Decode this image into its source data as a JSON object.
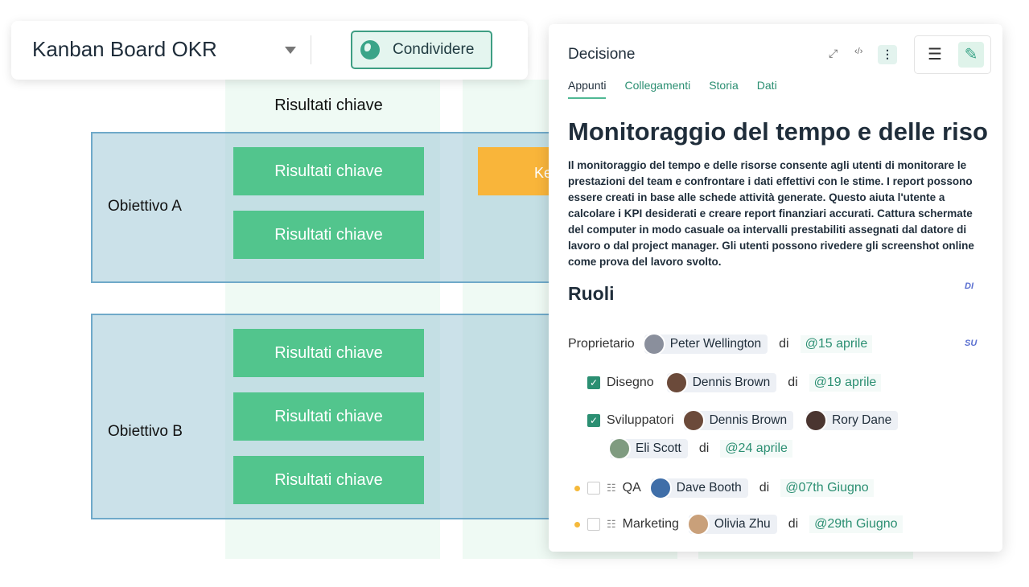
{
  "header": {
    "title": "Kanban Board OKR",
    "share_label": "Condividere"
  },
  "board": {
    "column_header": "Risultati chiave",
    "objectives": [
      {
        "label": "Obiettivo A",
        "key_results": [
          "Risultati chiave",
          "Risultati chiave"
        ],
        "orange_card": "Ke"
      },
      {
        "label": "Obiettivo B",
        "key_results": [
          "Risultati chiave",
          "Risultati chiave",
          "Risultati chiave"
        ]
      }
    ]
  },
  "panel": {
    "title": "Decisione",
    "tabs": [
      "Appunti",
      "Collegamenti",
      "Storia",
      "Dati"
    ],
    "heading": "Monitoraggio del tempo e delle riso",
    "description": "Il monitoraggio del tempo e delle risorse consente agli utenti di monitorare le prestazioni del team e confrontare i dati effettivi con le stime. I report possono essere creati in base alle schede attività generate. Questo aiuta l'utente a calcolare i KPI desiderati e creare report finanziari accurati. Cattura schermate del computer in modo casuale oa intervalli prestabiliti assegnati dal datore di lavoro o dal project manager. Gli utenti possono rivedere gli screenshot online come prova del lavoro svolto.",
    "roles_heading": "Ruoli",
    "side_labels": [
      "DI",
      "SU"
    ],
    "di": "di",
    "roles": [
      {
        "label": "Proprietario",
        "people": [
          "Peter Wellington"
        ],
        "date": "@15 aprile"
      },
      {
        "label": "Disegno",
        "checked": true,
        "people": [
          "Dennis Brown"
        ],
        "date": "@19 aprile"
      },
      {
        "label": "Sviluppatori",
        "checked": true,
        "people": [
          "Dennis Brown",
          "Rory Dane",
          "Eli Scott"
        ],
        "date": "@24 aprile"
      },
      {
        "label": "QA",
        "checked": false,
        "people": [
          "Dave Booth"
        ],
        "date": "@07th Giugno"
      },
      {
        "label": "Marketing",
        "checked": false,
        "people": [
          "Olivia Zhu"
        ],
        "date": "@29th Giugno"
      }
    ]
  },
  "colors": {
    "accent": "#2b8f72",
    "kr_card": "#52c58d",
    "orange": "#f9b53a",
    "objective_bg": "#c5dfe8"
  }
}
